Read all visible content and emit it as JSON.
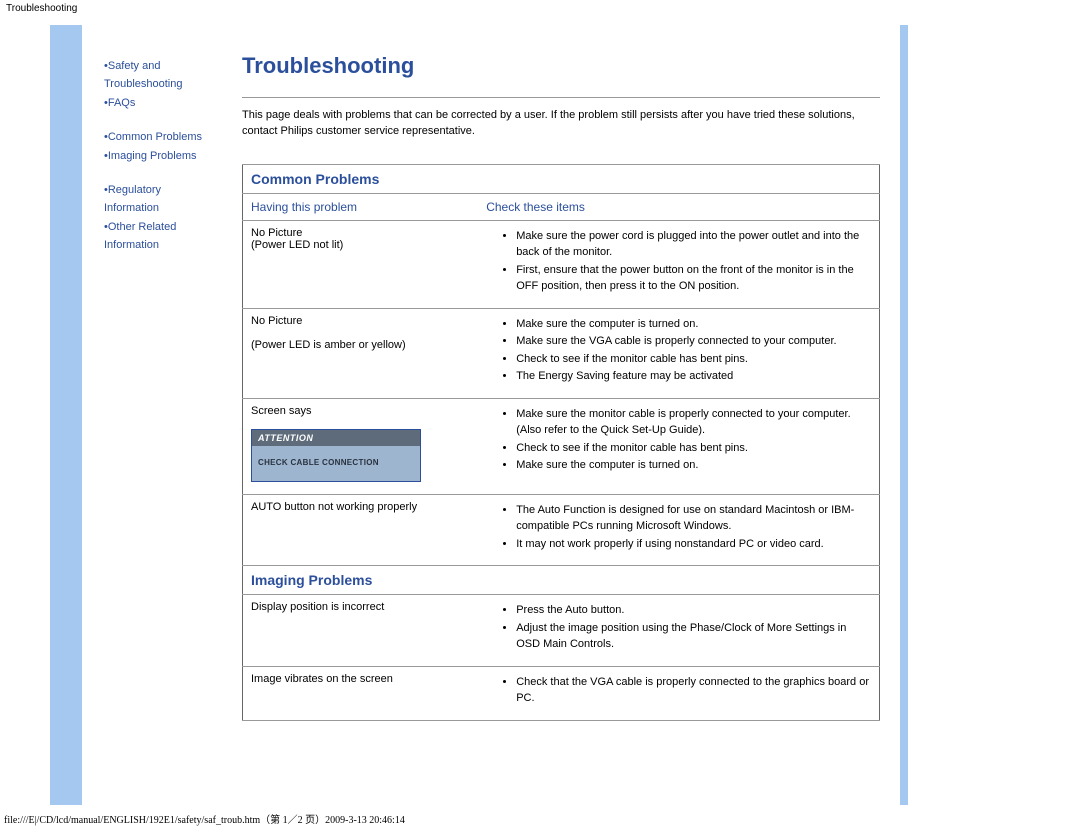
{
  "header_title": "Troubleshooting",
  "page_title": "Troubleshooting",
  "intro_text": "This page deals with problems that can be corrected by a user. If the problem still persists after you have tried these solutions, contact Philips customer service representative.",
  "sidebar": {
    "group1": [
      "Safety and Troubleshooting",
      "FAQs"
    ],
    "group2": [
      "Common Problems",
      "Imaging Problems"
    ],
    "group3": [
      "Regulatory Information",
      "Other Related Information"
    ]
  },
  "columns": {
    "left": "Having this problem",
    "right": "Check these items"
  },
  "sections": [
    {
      "heading": "Common Problems",
      "rows": [
        {
          "problem_lines": [
            "No Picture",
            "(Power LED not lit)"
          ],
          "checks": [
            "Make sure the power cord is plugged into the power outlet and into the back of the monitor.",
            "First, ensure that the power button on the front of the monitor is in the OFF position, then press it to the ON position."
          ]
        },
        {
          "problem_lines": [
            "No Picture",
            "",
            "(Power LED is amber or yellow)"
          ],
          "checks": [
            "Make sure the computer is turned on.",
            "Make sure the VGA cable is properly connected to your computer.",
            "Check to see if the monitor cable has bent pins.",
            "The Energy Saving feature may be activated"
          ]
        },
        {
          "problem_lines": [
            "Screen says"
          ],
          "attention": {
            "title": "ATTENTION",
            "body": "CHECK CABLE CONNECTION"
          },
          "checks": [
            "Make sure the monitor cable is properly connected to your computer. (Also refer to the Quick Set-Up Guide).",
            "Check to see if the monitor cable has bent pins.",
            "Make sure the computer is turned on."
          ]
        },
        {
          "problem_lines": [
            "AUTO button not working properly"
          ],
          "checks": [
            "The Auto Function is designed for use on standard Macintosh or IBM-compatible PCs running Microsoft Windows.",
            "It may not work properly if using nonstandard PC or video card."
          ]
        }
      ]
    },
    {
      "heading": "Imaging Problems",
      "rows": [
        {
          "problem_lines": [
            "Display position is incorrect"
          ],
          "checks": [
            "Press the Auto button.",
            "Adjust the image position using the Phase/Clock of More Settings in OSD Main Controls."
          ]
        },
        {
          "problem_lines": [
            "Image vibrates on the screen"
          ],
          "checks": [
            "Check that the VGA cable is properly connected to the graphics board or PC."
          ]
        }
      ]
    }
  ],
  "footer_path": "file:///E|/CD/lcd/manual/ENGLISH/192E1/safety/saf_troub.htm（第 1／2 页）2009-3-13 20:46:14"
}
